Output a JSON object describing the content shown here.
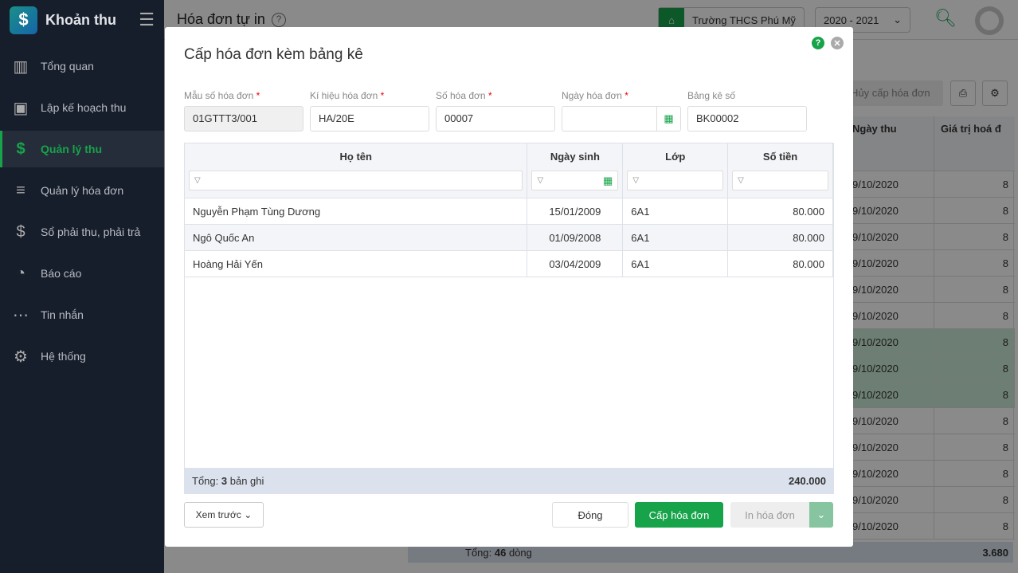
{
  "sidebar": {
    "app_title": "Khoản thu",
    "items": [
      {
        "label": "Tổng quan",
        "icon": "bar-chart-icon"
      },
      {
        "label": "Lập kế hoạch thu",
        "icon": "calendar-dollar-icon"
      },
      {
        "label": "Quản lý thu",
        "icon": "hand-coin-icon",
        "active": true
      },
      {
        "label": "Quản lý hóa đơn",
        "icon": "document-icon"
      },
      {
        "label": "Sổ phải thu, phải trả",
        "icon": "ledger-icon"
      },
      {
        "label": "Báo cáo",
        "icon": "pie-chart-icon"
      },
      {
        "label": "Tin nhắn",
        "icon": "message-icon"
      },
      {
        "label": "Hệ thống",
        "icon": "gear-icon"
      }
    ]
  },
  "header": {
    "title": "Hóa đơn tự in",
    "school": "Trường THCS Phú Mỹ",
    "year": "2020 - 2021"
  },
  "background": {
    "cancel_button": "Hủy cấp hóa đơn",
    "col_date": "Ngày thu",
    "col_value": "Giá trị hoá đ",
    "row_date": "9/10/2020",
    "row_value": "8",
    "total_label": "Tổng:",
    "total_count": "46",
    "total_unit": "dòng",
    "total_value": "3.680"
  },
  "modal": {
    "title": "Cấp hóa đơn kèm bảng kê",
    "fields": {
      "template_label": "Mẫu số hóa đơn",
      "template_value": "01GTTT3/001",
      "symbol_label": "Kí hiệu hóa đơn",
      "symbol_value": "HA/20E",
      "number_label": "Số hóa đơn",
      "number_value": "00007",
      "date_label": "Ngày hóa đơn",
      "date_value": "",
      "list_label": "Bảng kê số",
      "list_value": "BK00002",
      "required": "*"
    },
    "columns": [
      "Họ tên",
      "Ngày sinh",
      "Lớp",
      "Số tiền"
    ],
    "rows": [
      [
        "Nguyễn Phạm Tùng Dương",
        "15/01/2009",
        "6A1",
        "80.000"
      ],
      [
        "Ngô Quốc An",
        "01/09/2008",
        "6A1",
        "80.000"
      ],
      [
        "Hoàng Hải Yến",
        "03/04/2009",
        "6A1",
        "80.000"
      ]
    ],
    "footer": {
      "total_label": "Tổng:",
      "total_count": "3",
      "total_unit": "bản ghi",
      "total_amount": "240.000"
    },
    "buttons": {
      "preview": "Xem trước",
      "close": "Đóng",
      "issue": "Cấp hóa đơn",
      "print": "In hóa đơn"
    }
  },
  "colors": {
    "accent": "#17a34a",
    "sidebar": "#171e2b"
  }
}
